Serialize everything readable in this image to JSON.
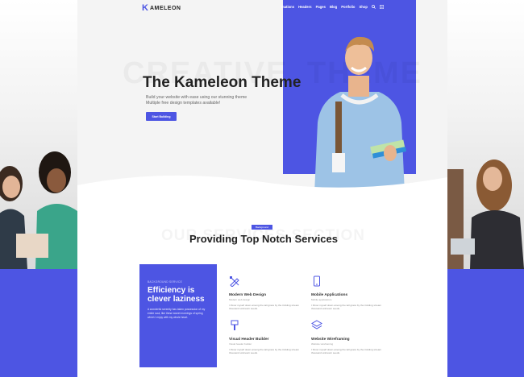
{
  "colors": {
    "accent": "#4d55e3",
    "hero_bg": "#f4f4f4",
    "dark_text": "#222222"
  },
  "brand": {
    "mark": "K",
    "name": "AMELEON"
  },
  "nav": {
    "items": [
      "mations",
      "Headers",
      "Pages",
      "Blog",
      "Portfolio",
      "Shop"
    ],
    "icons": [
      "search-icon",
      "menu-icon"
    ]
  },
  "hero": {
    "bg_text_left": "CREATIVE",
    "bg_text_right": "THEME",
    "title": "The Kameleon Theme",
    "subtitle_line1": "Build your website with ease using our stunning theme",
    "subtitle_line2": "Multiple free design templates available!",
    "button": "Start Building"
  },
  "services": {
    "badge": "Background",
    "bg_text": "OUR SERVICES SECTION",
    "title": "Providing Top Notch Services",
    "card": {
      "label": "BACKGROUND SERVICE",
      "title_line1": "Efficiency is",
      "title_line2": "clever laziness",
      "text": "A wonderful serenity has taken possession of my entire soul, like these sweet mornings of spring which I enjoy with my whole heart."
    },
    "items": [
      {
        "icon": "pencil-ruler-icon",
        "name": "Modern Web Design",
        "sub": "Modern web design",
        "desc": "I throw myself down among the tall grass by the trickling stream thousand unknown seeds."
      },
      {
        "icon": "mobile-icon",
        "name": "Mobile Applications",
        "sub": "Mobile applications",
        "desc": "I throw myself down among the tall grass by the trickling stream thousand unknown seeds."
      },
      {
        "icon": "brush-icon",
        "name": "Visual Header Builder",
        "sub": "Visual header builder",
        "desc": "I throw myself down among the tall grass by the trickling stream thousand unknown seeds."
      },
      {
        "icon": "layers-icon",
        "name": "Website Wireframing",
        "sub": "Website wireframing",
        "desc": "I throw myself down among the tall grass by the trickling stream thousand unknown seeds."
      }
    ]
  }
}
